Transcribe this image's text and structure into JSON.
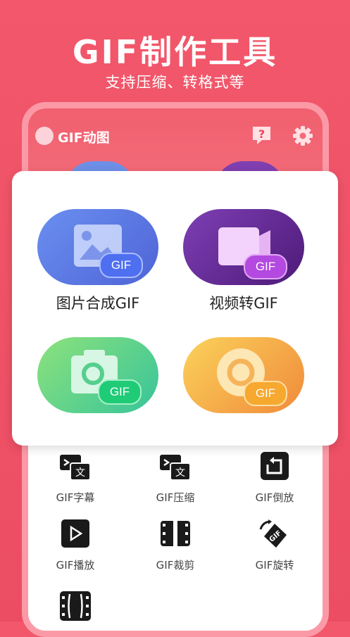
{
  "hero": {
    "title": "GIF制作工具",
    "subtitle": "支持压缩、转格式等"
  },
  "app": {
    "title": "GIF动图"
  },
  "features": [
    {
      "label": "图片合成GIF",
      "tag": "GIF"
    },
    {
      "label": "视频转GIF",
      "tag": "GIF"
    },
    {
      "label": "",
      "tag": "GIF"
    },
    {
      "label": "",
      "tag": "GIF"
    }
  ],
  "tools": [
    {
      "label": "GIF字幕",
      "icon": "subtitle-icon"
    },
    {
      "label": "GIF压缩",
      "icon": "compress-icon"
    },
    {
      "label": "GIF倒放",
      "icon": "reverse-icon"
    },
    {
      "label": "GIF播放",
      "icon": "play-icon"
    },
    {
      "label": "GIF裁剪",
      "icon": "crop-film-icon"
    },
    {
      "label": "GIF旋转",
      "icon": "rotate-icon"
    },
    {
      "label": "",
      "icon": "film-strip-icon"
    }
  ],
  "colors": {
    "background": "#f2576b",
    "accent_blue": "#5b7de8",
    "accent_purple": "#6b2d9c",
    "accent_green": "#4fd18a",
    "accent_orange": "#f4a23c"
  }
}
